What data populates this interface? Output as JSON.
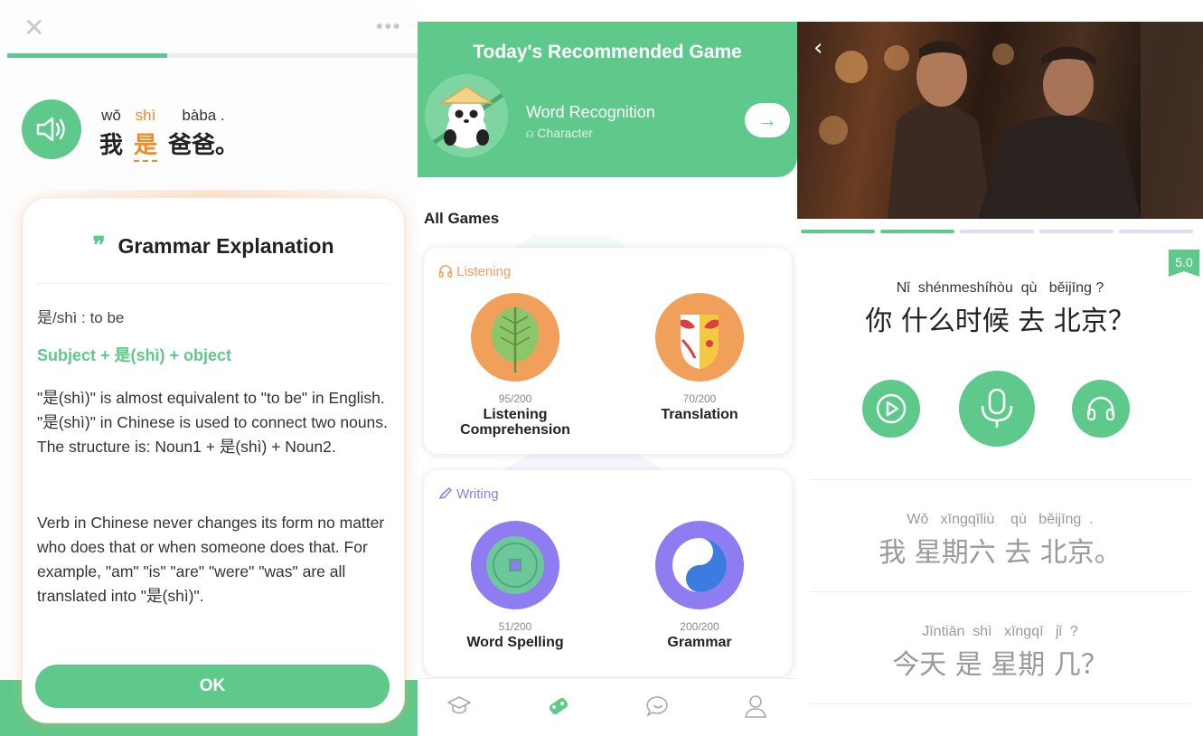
{
  "grammar_screen": {
    "close_icon": "close-icon",
    "more_icon": "more-icon",
    "progress": 0.39,
    "sentence": [
      {
        "pinyin": "wǒ",
        "hanzi": "我",
        "highlight": false
      },
      {
        "pinyin": "shì",
        "hanzi": "是",
        "highlight": true
      },
      {
        "pinyin": "bàba .",
        "hanzi": "爸爸。",
        "highlight": false
      }
    ],
    "card": {
      "title": "Grammar Explanation",
      "definition": "是/shì : to be",
      "formula": "Subject + 是(shì) + object",
      "paragraph1": "\"是(shì)\"  is almost equivalent to \"to be\" in English. \"是(shì)\" in Chinese is used to connect two nouns. The structure is: Noun1 + 是(shì) + Noun2.",
      "paragraph2": "Verb in Chinese never changes its form no matter who does that or when someone does that. For example, \"am\" \"is\" \"are\" \"were\" \"was\" are all translated into \"是(shì)\".",
      "ok_label": "OK"
    }
  },
  "games_screen": {
    "hero": {
      "title": "Today's Recommended Game",
      "game_name": "Word Recognition",
      "game_sub": "Character",
      "arrow": "→"
    },
    "all_games_label": "All Games",
    "sections": [
      {
        "label": "Listening",
        "icon": "headphones-icon",
        "color": "#f0a05a",
        "games": [
          {
            "name": "Listening Comprehension",
            "count": "95/200",
            "icon": "leaf-icon"
          },
          {
            "name": "Translation",
            "count": "70/200",
            "icon": "opera-mask-icon"
          }
        ]
      },
      {
        "label": "Writing",
        "icon": "pencil-icon",
        "color": "#8e7cf0",
        "games": [
          {
            "name": "Word Spelling",
            "count": "51/200",
            "icon": "coin-icon"
          },
          {
            "name": "Grammar",
            "count": "200/200",
            "icon": "yin-yang-icon"
          }
        ]
      }
    ],
    "tabs": [
      "graduation-cap-icon",
      "games-icon",
      "chat-icon",
      "profile-icon"
    ],
    "active_tab": 1
  },
  "speaking_screen": {
    "back_icon": "chevron-left-icon",
    "segments_done": 2,
    "segments_total": 5,
    "score": "5.0",
    "prompt": {
      "pinyin": "Nǐ  shénmeshíhòu  qù   běijīng ?",
      "hanzi": "你 什么时候 去 北京？"
    },
    "controls": [
      "play-icon",
      "microphone-icon",
      "headphones-icon"
    ],
    "answers": [
      {
        "pinyin": "Wǒ   xīngqīliù    qù   běijīng  .",
        "hanzi": "我 星期六 去 北京。"
      },
      {
        "pinyin": "Jīntiān  shì   xīngqī   jǐ  ?",
        "hanzi": "今天 是 星期 几？"
      }
    ],
    "colors": {
      "accent": "#5ec98b",
      "inactive_segment": "#dcdcf0"
    }
  }
}
